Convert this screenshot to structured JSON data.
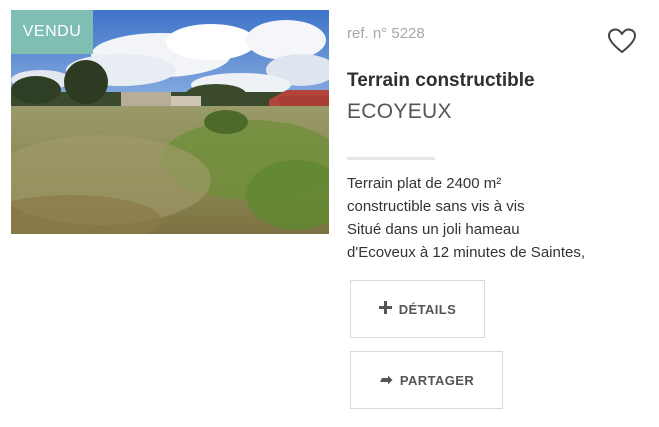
{
  "listing": {
    "status_badge": "VENDU",
    "reference": "ref. n° 5228",
    "title": "Terrain constructible",
    "city": "ECOYEUX",
    "description": "Terrain plat de 2400 m²\nconstructible sans vis à vis\nSitué dans un joli hameau\nd'Ecoveux à 12 minutes de Saintes,"
  },
  "actions": {
    "details_label": "DÉTAILS",
    "share_label": "PARTAGER"
  },
  "icons": {
    "favorite": "heart-outline-icon",
    "details": "plus-icon",
    "share": "share-arrow-icon"
  },
  "colors": {
    "badge_bg": "#7fbfb3",
    "badge_text": "#ffffff",
    "reference_text": "#a8a8a8",
    "button_border": "#d9d9d9"
  }
}
